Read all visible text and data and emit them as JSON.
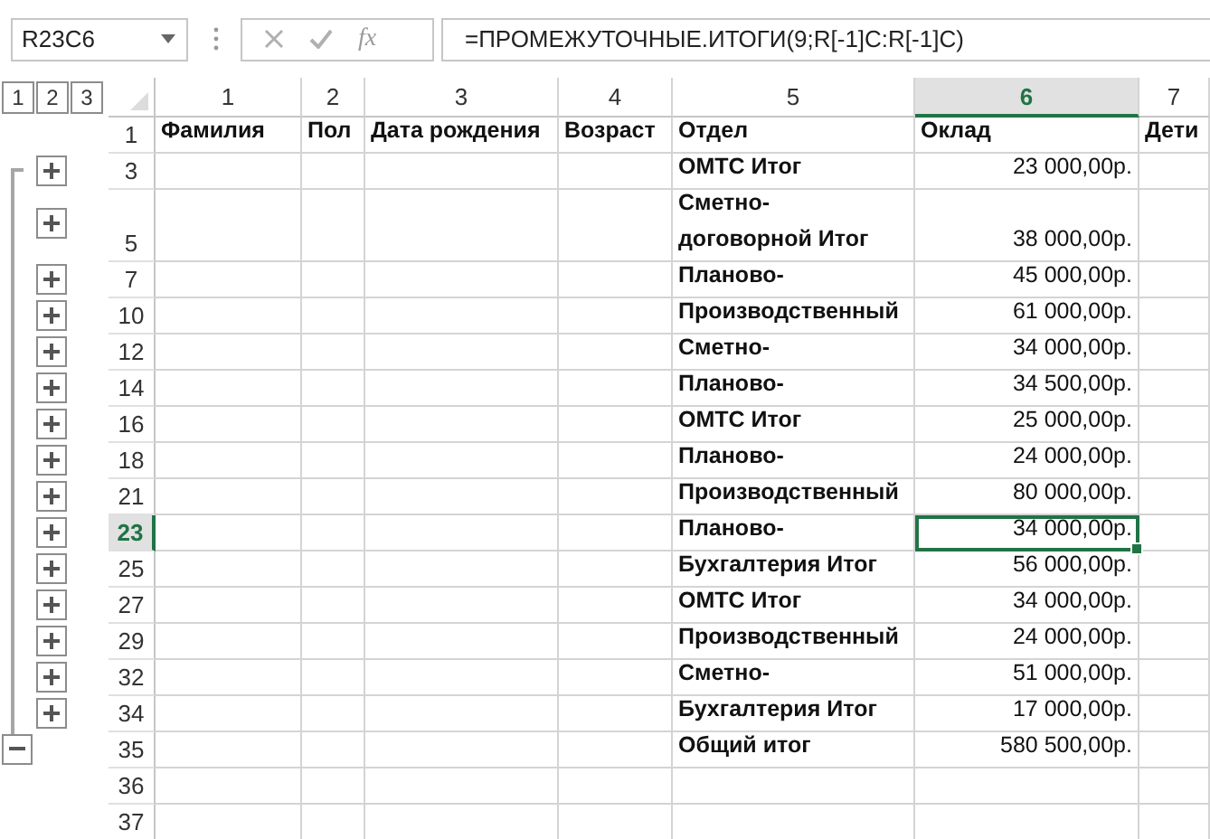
{
  "name_box": "R23C6",
  "formula_bar": {
    "function_button": "fx",
    "formula": "=ПРОМЕЖУТОЧНЫЕ.ИТОГИ(9;R[-1]C:R[-1]C)"
  },
  "outline_levels": [
    "1",
    "2",
    "3"
  ],
  "columns": [
    {
      "label": "1",
      "selected": false
    },
    {
      "label": "2",
      "selected": false
    },
    {
      "label": "3",
      "selected": false
    },
    {
      "label": "4",
      "selected": false
    },
    {
      "label": "5",
      "selected": false
    },
    {
      "label": "6",
      "selected": true
    },
    {
      "label": "7",
      "selected": false
    }
  ],
  "rows": [
    {
      "number": "1",
      "kind": "plain",
      "tall": false,
      "selected": false,
      "cells": [
        {
          "text": "Фамилия",
          "kind": "text"
        },
        {
          "text": "Пол",
          "kind": "text"
        },
        {
          "text": "Дата рождения",
          "kind": "text"
        },
        {
          "text": "Возраст",
          "kind": "text"
        },
        {
          "text": "Отдел",
          "kind": "text"
        },
        {
          "text": "Оклад",
          "kind": "text"
        },
        {
          "text": "Дети",
          "kind": "text"
        }
      ]
    },
    {
      "number": "3",
      "kind": "collapsed",
      "tall": false,
      "selected": false,
      "cells": [
        null,
        null,
        null,
        null,
        {
          "text": "ОМТС Итог",
          "kind": "text"
        },
        {
          "text": "23 000,00р.",
          "kind": "money"
        },
        null
      ]
    },
    {
      "number": "5",
      "kind": "collapsed",
      "tall": true,
      "selected": false,
      "cells": [
        null,
        null,
        null,
        null,
        {
          "text": "Сметно-\nдоговорной Итог",
          "kind": "text"
        },
        {
          "text": "38 000,00р.",
          "kind": "money"
        },
        null
      ]
    },
    {
      "number": "7",
      "kind": "collapsed",
      "tall": false,
      "selected": false,
      "cells": [
        null,
        null,
        null,
        null,
        {
          "text": "Планово-",
          "kind": "text"
        },
        {
          "text": "45 000,00р.",
          "kind": "money"
        },
        null
      ]
    },
    {
      "number": "10",
      "kind": "collapsed",
      "tall": false,
      "selected": false,
      "cells": [
        null,
        null,
        null,
        null,
        {
          "text": "Производственный",
          "kind": "text"
        },
        {
          "text": "61 000,00р.",
          "kind": "money"
        },
        null
      ]
    },
    {
      "number": "12",
      "kind": "collapsed",
      "tall": false,
      "selected": false,
      "cells": [
        null,
        null,
        null,
        null,
        {
          "text": "Сметно-",
          "kind": "text"
        },
        {
          "text": "34 000,00р.",
          "kind": "money"
        },
        null
      ]
    },
    {
      "number": "14",
      "kind": "collapsed",
      "tall": false,
      "selected": false,
      "cells": [
        null,
        null,
        null,
        null,
        {
          "text": "Планово-",
          "kind": "text"
        },
        {
          "text": "34 500,00р.",
          "kind": "money"
        },
        null
      ]
    },
    {
      "number": "16",
      "kind": "collapsed",
      "tall": false,
      "selected": false,
      "cells": [
        null,
        null,
        null,
        null,
        {
          "text": "ОМТС Итог",
          "kind": "text"
        },
        {
          "text": "25 000,00р.",
          "kind": "money"
        },
        null
      ]
    },
    {
      "number": "18",
      "kind": "collapsed",
      "tall": false,
      "selected": false,
      "cells": [
        null,
        null,
        null,
        null,
        {
          "text": "Планово-",
          "kind": "text"
        },
        {
          "text": "24 000,00р.",
          "kind": "money"
        },
        null
      ]
    },
    {
      "number": "21",
      "kind": "collapsed",
      "tall": false,
      "selected": false,
      "cells": [
        null,
        null,
        null,
        null,
        {
          "text": "Производственный",
          "kind": "text"
        },
        {
          "text": "80 000,00р.",
          "kind": "money"
        },
        null
      ]
    },
    {
      "number": "23",
      "kind": "collapsed",
      "tall": false,
      "selected": true,
      "cells": [
        null,
        null,
        null,
        null,
        {
          "text": "Планово-",
          "kind": "text"
        },
        {
          "text": "34 000,00р.",
          "kind": "money",
          "selected": true
        },
        null
      ]
    },
    {
      "number": "25",
      "kind": "collapsed",
      "tall": false,
      "selected": false,
      "cells": [
        null,
        null,
        null,
        null,
        {
          "text": "Бухгалтерия Итог",
          "kind": "text"
        },
        {
          "text": "56 000,00р.",
          "kind": "money"
        },
        null
      ]
    },
    {
      "number": "27",
      "kind": "collapsed",
      "tall": false,
      "selected": false,
      "cells": [
        null,
        null,
        null,
        null,
        {
          "text": "ОМТС Итог",
          "kind": "text"
        },
        {
          "text": "34 000,00р.",
          "kind": "money"
        },
        null
      ]
    },
    {
      "number": "29",
      "kind": "collapsed",
      "tall": false,
      "selected": false,
      "cells": [
        null,
        null,
        null,
        null,
        {
          "text": "Производственный",
          "kind": "text"
        },
        {
          "text": "24 000,00р.",
          "kind": "money"
        },
        null
      ]
    },
    {
      "number": "32",
      "kind": "collapsed",
      "tall": false,
      "selected": false,
      "cells": [
        null,
        null,
        null,
        null,
        {
          "text": "Сметно-",
          "kind": "text"
        },
        {
          "text": "51 000,00р.",
          "kind": "money"
        },
        null
      ]
    },
    {
      "number": "34",
      "kind": "collapsed",
      "tall": false,
      "selected": false,
      "cells": [
        null,
        null,
        null,
        null,
        {
          "text": "Бухгалтерия Итог",
          "kind": "text"
        },
        {
          "text": "17 000,00р.",
          "kind": "money"
        },
        null
      ]
    },
    {
      "number": "35",
      "kind": "expanded",
      "tall": false,
      "selected": false,
      "cells": [
        null,
        null,
        null,
        null,
        {
          "text": "Общий итог",
          "kind": "text"
        },
        {
          "text": "580 500,00р.",
          "kind": "money"
        },
        null
      ]
    },
    {
      "number": "36",
      "kind": "plain",
      "tall": false,
      "selected": false,
      "cells": [
        null,
        null,
        null,
        null,
        null,
        null,
        null
      ]
    },
    {
      "number": "37",
      "kind": "plain",
      "tall": false,
      "selected": false,
      "cells": [
        null,
        null,
        null,
        null,
        null,
        null,
        null
      ]
    }
  ]
}
